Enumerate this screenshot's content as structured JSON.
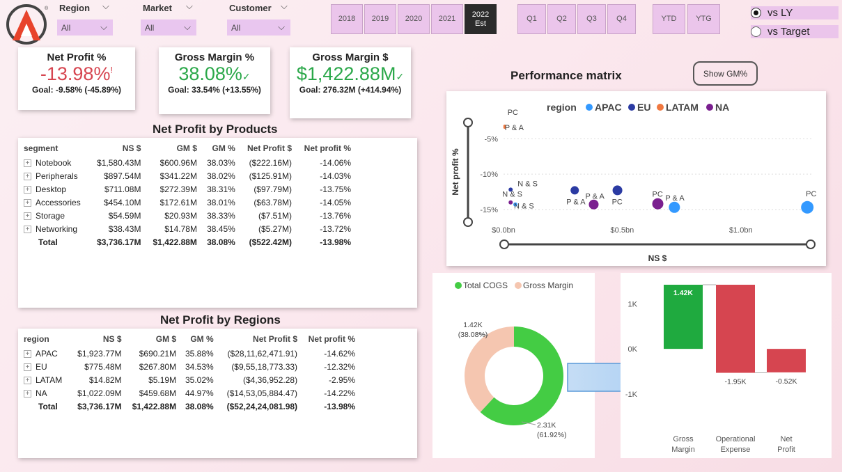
{
  "slicers": [
    {
      "label": "Region",
      "value": "All"
    },
    {
      "label": "Market",
      "value": "All"
    },
    {
      "label": "Customer",
      "value": "All"
    }
  ],
  "years": [
    "2018",
    "2019",
    "2020",
    "2021"
  ],
  "year_selected": {
    "line1": "2022",
    "line2": "Est"
  },
  "quarters": [
    "Q1",
    "Q2",
    "Q3",
    "Q4"
  ],
  "periods": [
    "YTD",
    "YTG"
  ],
  "compare": {
    "vs_ly": "vs LY",
    "vs_target": "vs Target"
  },
  "kpis": {
    "net_profit": {
      "title": "Net Profit %",
      "value": "-13.98%",
      "flag": "!",
      "goal": "Goal: -9.58% (-45.89%)"
    },
    "gm_pct": {
      "title": "Gross Margin %",
      "value": "38.08%",
      "flag": "✓",
      "goal": "Goal: 33.54% (+13.55%)"
    },
    "gm_usd": {
      "title": "Gross Margin $",
      "value": "$1,422.88M",
      "flag": "✓",
      "goal": "Goal: 276.32M (+414.94%)"
    }
  },
  "colors": {
    "red": "#d64550",
    "green": "#2ba84a",
    "apac": "#3399ff",
    "eu": "#2b3ba3",
    "latam": "#f07840",
    "na": "#7a1f8f",
    "cogs": "#44cc44",
    "gm": "#f5c6b0"
  },
  "products": {
    "title": "Net Profit by Products",
    "headers": [
      "segment",
      "NS $",
      "GM $",
      "GM %",
      "Net Profit $",
      "Net profit %"
    ],
    "rows": [
      {
        "segment": "Notebook",
        "ns": "$1,580.43M",
        "gm": "$600.96M",
        "gmp": "38.03%",
        "np": "($222.16M)",
        "npp": "-14.06%"
      },
      {
        "segment": "Peripherals",
        "ns": "$897.54M",
        "gm": "$341.22M",
        "gmp": "38.02%",
        "np": "($125.91M)",
        "npp": "-14.03%"
      },
      {
        "segment": "Desktop",
        "ns": "$711.08M",
        "gm": "$272.39M",
        "gmp": "38.31%",
        "np": "($97.79M)",
        "npp": "-13.75%"
      },
      {
        "segment": "Accessories",
        "ns": "$454.10M",
        "gm": "$172.61M",
        "gmp": "38.01%",
        "np": "($63.78M)",
        "npp": "-14.05%"
      },
      {
        "segment": "Storage",
        "ns": "$54.59M",
        "gm": "$20.93M",
        "gmp": "38.33%",
        "np": "($7.51M)",
        "npp": "-13.76%"
      },
      {
        "segment": "Networking",
        "ns": "$38.43M",
        "gm": "$14.78M",
        "gmp": "38.45%",
        "np": "($5.27M)",
        "npp": "-13.72%"
      }
    ],
    "total": {
      "segment": "Total",
      "ns": "$3,736.17M",
      "gm": "$1,422.88M",
      "gmp": "38.08%",
      "np": "($522.42M)",
      "npp": "-13.98%"
    }
  },
  "regions": {
    "title": "Net Profit by Regions",
    "headers": [
      "region",
      "NS $",
      "GM $",
      "GM %",
      "Net Profit $",
      "Net profit %"
    ],
    "rows": [
      {
        "segment": "APAC",
        "ns": "$1,923.77M",
        "gm": "$690.21M",
        "gmp": "35.88%",
        "np": "($28,11,62,471.91)",
        "npp": "-14.62%"
      },
      {
        "segment": "EU",
        "ns": "$775.48M",
        "gm": "$267.80M",
        "gmp": "34.53%",
        "np": "($9,55,18,773.33)",
        "npp": "-12.32%"
      },
      {
        "segment": "LATAM",
        "ns": "$14.82M",
        "gm": "$5.19M",
        "gmp": "35.02%",
        "np": "($4,36,952.28)",
        "npp": "-2.95%"
      },
      {
        "segment": "NA",
        "ns": "$1,022.09M",
        "gm": "$459.68M",
        "gmp": "44.97%",
        "np": "($14,53,05,884.47)",
        "npp": "-14.22%"
      }
    ],
    "total": {
      "segment": "Total",
      "ns": "$3,736.17M",
      "gm": "$1,422.88M",
      "gmp": "38.08%",
      "np": "($52,24,24,081.98)",
      "npp": "-13.98%"
    }
  },
  "matrix": {
    "title": "Performance matrix",
    "show_button": "Show GM%",
    "legend_title": "region",
    "ylabel": "Net profit %",
    "xlabel": "NS $"
  },
  "chart_data": [
    {
      "type": "scatter",
      "xlabel": "NS $",
      "ylabel": "Net profit %",
      "x_ticks": [
        "$0.0bn",
        "$0.5bn",
        "$1.0bn"
      ],
      "y_ticks": [
        "-5%",
        "-10%",
        "-15%"
      ],
      "xlim": [
        0,
        1.3
      ],
      "ylim": [
        -16,
        -3
      ],
      "legend": [
        "APAC",
        "EU",
        "LATAM",
        "NA"
      ],
      "points": [
        {
          "series": "LATAM",
          "label": "PC",
          "x": 0.005,
          "y": -3.2,
          "r": 2
        },
        {
          "series": "LATAM",
          "label": "P & A",
          "x": 0.005,
          "y": -3.4,
          "r": 2
        },
        {
          "series": "EU",
          "label": "N & S",
          "x": 0.03,
          "y": -12.2,
          "r": 3
        },
        {
          "series": "NA",
          "label": "N & S",
          "x": 0.03,
          "y": -14.0,
          "r": 3
        },
        {
          "series": "APAC",
          "label": "N & S",
          "x": 0.05,
          "y": -14.3,
          "r": 3
        },
        {
          "series": "EU",
          "label": "P & A",
          "x": 0.3,
          "y": -12.3,
          "r": 6
        },
        {
          "series": "NA",
          "label": "P & A",
          "x": 0.38,
          "y": -14.3,
          "r": 7
        },
        {
          "series": "EU",
          "label": "PC",
          "x": 0.48,
          "y": -12.3,
          "r": 7
        },
        {
          "series": "NA",
          "label": "PC",
          "x": 0.65,
          "y": -14.2,
          "r": 8
        },
        {
          "series": "APAC",
          "label": "P & A",
          "x": 0.72,
          "y": -14.7,
          "r": 8
        },
        {
          "series": "APAC",
          "label": "PC",
          "x": 1.28,
          "y": -14.7,
          "r": 9
        }
      ]
    },
    {
      "type": "pie",
      "legend": [
        "Total COGS",
        "Gross Margin"
      ],
      "slices": [
        {
          "name": "Total COGS",
          "value": 2.31,
          "label1": "2.31K",
          "label2": "(61.92%)"
        },
        {
          "name": "Gross Margin",
          "value": 1.42,
          "label1": "1.42K",
          "label2": "(38.08%)"
        }
      ]
    },
    {
      "type": "bar",
      "categories": [
        "Gross Margin",
        "Operational Expense",
        "Net Profit"
      ],
      "values": [
        1.42,
        -1.95,
        -0.52
      ],
      "labels": [
        "1.42K",
        "-1.95K",
        "-0.52K"
      ],
      "y_ticks": [
        "1K",
        "0K",
        "-1K"
      ],
      "ylim": [
        -1.2,
        1.42
      ]
    }
  ]
}
